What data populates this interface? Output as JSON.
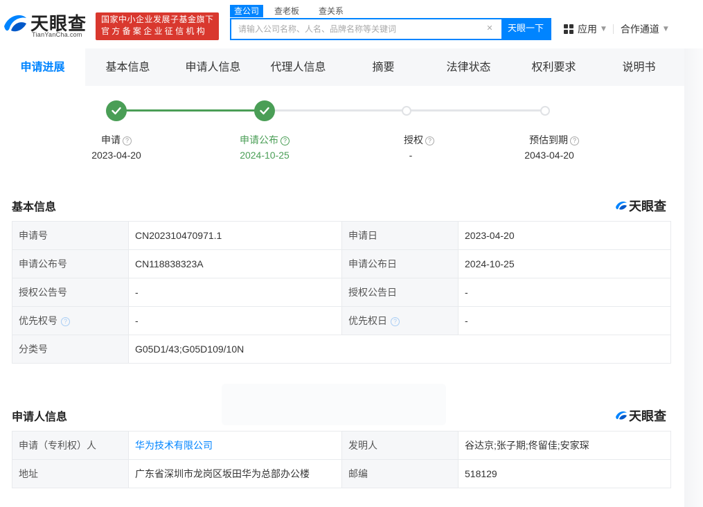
{
  "header": {
    "logo_cn": "天眼查",
    "logo_en": "TianYanCha.com",
    "badge_line1": "国家中小企业发展子基金旗下",
    "badge_line2": "官方备案企业征信机构",
    "search_tabs": [
      "查公司",
      "查老板",
      "查关系"
    ],
    "search_placeholder": "请输入公司名称、人名、品牌名称等关键词",
    "search_button": "天眼一下",
    "apps_label": "应用",
    "partner_label": "合作通道"
  },
  "tabs": [
    "申请进展",
    "基本信息",
    "申请人信息",
    "代理人信息",
    "摘要",
    "法律状态",
    "权利要求",
    "说明书"
  ],
  "progress": {
    "steps": [
      {
        "label": "申请",
        "date": "2023-04-20",
        "done": true
      },
      {
        "label": "申请公布",
        "date": "2024-10-25",
        "done": true
      },
      {
        "label": "授权",
        "date": "-",
        "done": false
      },
      {
        "label": "预估到期",
        "date": "2043-04-20",
        "done": false
      }
    ]
  },
  "basic_info": {
    "title": "基本信息",
    "brand": "天眼查",
    "rows": [
      {
        "k1": "申请号",
        "v1": "CN202310470971.1",
        "k2": "申请日",
        "v2": "2023-04-20"
      },
      {
        "k1": "申请公布号",
        "v1": "CN118838323A",
        "k2": "申请公布日",
        "v2": "2024-10-25"
      },
      {
        "k1": "授权公告号",
        "v1": "-",
        "k2": "授权公告日",
        "v2": "-"
      },
      {
        "k1": "优先权号",
        "v1": "-",
        "k2": "优先权日",
        "v2": "-"
      }
    ],
    "class_label": "分类号",
    "class_value": "G05D1/43;G05D109/10N"
  },
  "applicant_info": {
    "title": "申请人信息",
    "brand": "天眼查",
    "applicant_label": "申请（专利权）人",
    "applicant_value": "华为技术有限公司",
    "inventor_label": "发明人",
    "inventor_value": "谷达京;张子期;佟留佳;安家琛",
    "address_label": "地址",
    "address_value": "广东省深圳市龙岗区坂田华为总部办公楼",
    "zip_label": "邮编",
    "zip_value": "518129"
  },
  "colors": {
    "accent": "#0084ff",
    "done": "#4a9e56",
    "badge": "#d9382e"
  }
}
